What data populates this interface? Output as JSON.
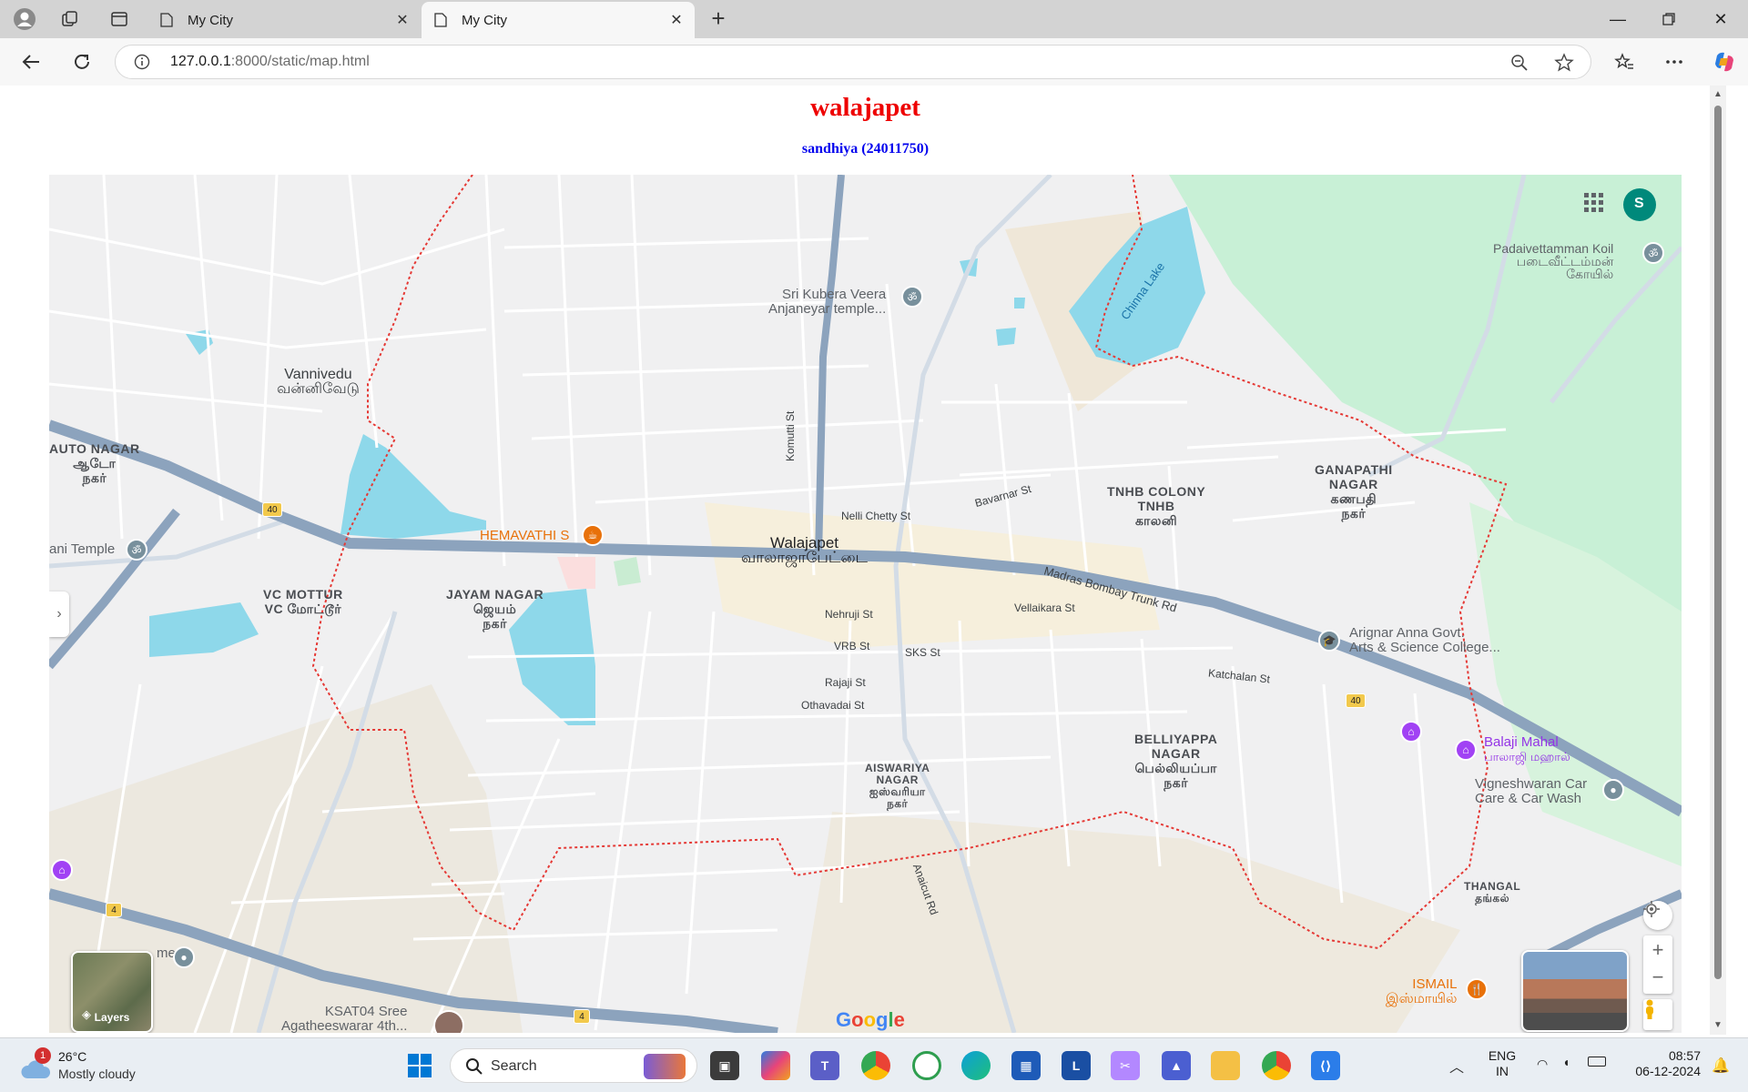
{
  "browser": {
    "tabs": [
      {
        "title": "My City",
        "active": false
      },
      {
        "title": "My City",
        "active": true
      }
    ],
    "url_host": "127.0.0.1",
    "url_path": ":8000/static/map.html"
  },
  "page": {
    "title": "walajapet",
    "subtitle": "sandhiya (24011750)"
  },
  "map": {
    "town": {
      "en": "Walajapet",
      "ta": "வாலாஜாபேட்டை"
    },
    "areas": [
      {
        "lines": [
          "Vannivedu",
          "வன்னிவேடு"
        ]
      },
      {
        "lines": [
          "AUTO NAGAR",
          "ஆடோ",
          "நகர்"
        ]
      },
      {
        "lines": [
          "VC MOTTUR",
          "VC மோட்டூர்"
        ]
      },
      {
        "lines": [
          "JAYAM NAGAR",
          "ஜெயம்",
          "நகர்"
        ]
      },
      {
        "lines": [
          "TNHB COLONY",
          "TNHB",
          "காலனி"
        ]
      },
      {
        "lines": [
          "GANAPATHI",
          "NAGAR",
          "கணபதி",
          "நகர்"
        ]
      },
      {
        "lines": [
          "BELLIYAPPA",
          "NAGAR",
          "பெல்லியப்பா",
          "நகர்"
        ]
      },
      {
        "lines": [
          "AISWARIYA",
          "NAGAR",
          "ஐஸ்வரியா",
          "நகர்"
        ]
      },
      {
        "lines": [
          "THANGAL",
          "தங்கல்"
        ]
      }
    ],
    "streets": [
      "Komutti St",
      "Nelli Chetty St",
      "Bavarnar St",
      "Madras Bombay Trunk Rd",
      "Vellaikara St",
      "Nehruji St",
      "VRB St",
      "SKS St",
      "Rajaji St",
      "Othavadai St",
      "Katchalan St",
      "Anaicut Rd"
    ],
    "road_shields": [
      "40",
      "40",
      "4",
      "4"
    ],
    "pois": [
      {
        "name": "Sri Kubera Veera",
        "name2": "Anjaneyar temple...",
        "icon": "om-icon"
      },
      {
        "name": "HEMAVATHI S",
        "icon": "cafe-icon"
      },
      {
        "name": "ani Temple",
        "icon": "om-icon"
      },
      {
        "name": "Padaivettamman Koil",
        "name2": "படைவீட்டம்மன்",
        "name3": "கோயில்",
        "icon": "om-icon"
      },
      {
        "name": "Arignar Anna Govt.",
        "name2": "Arts & Science College...",
        "icon": "school-icon"
      },
      {
        "name": "Balaji Mahal",
        "name2": "பாலாஜி மஹால்",
        "icon": "hall-icon"
      },
      {
        "name": "Vigneshwaran Car",
        "name2": "Care & Car Wash",
        "icon": "pin-icon"
      },
      {
        "name": "ISMAIL",
        "name2": "இஸ்மாயில்",
        "icon": "restaurant-icon"
      },
      {
        "name": "KSAT04 Sree",
        "name2": "Agatheeswarar 4th...",
        "icon": "temple-icon"
      },
      {
        "name": "me",
        "icon": "pin-icon"
      }
    ],
    "water": [
      "Chinna Lake"
    ],
    "brand": "Google",
    "controls": {
      "layers": "Layers",
      "zoom_in": "+",
      "zoom_out": "−",
      "account_initial": "S"
    }
  },
  "taskbar": {
    "weather_temp": "26°C",
    "weather_desc": "Mostly cloudy",
    "weather_badge": "1",
    "search_label": "Search",
    "lang_top": "ENG",
    "lang_bottom": "IN",
    "time": "08:57",
    "date": "06-12-2024"
  }
}
